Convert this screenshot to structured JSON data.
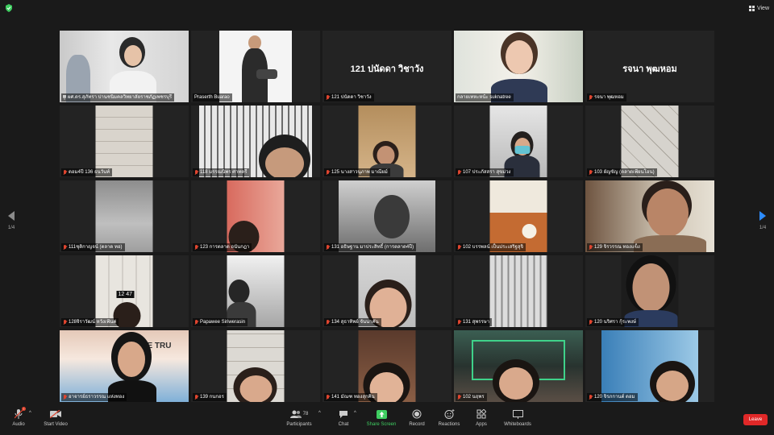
{
  "header": {
    "view_label": "View"
  },
  "pagination": {
    "left": "1/4",
    "right": "1/4"
  },
  "tiles": [
    "ผศ.ดร.สุภัทรา ปานชนิมคลวิทยาลัยราชภัฏเพชรบุรี",
    "Praserth Buarao",
    "121 ปนัดดา วิชาวัง",
    "กลายเทหะหน้ะ suknatree",
    "รจนา พุฒหอม",
    "ดอม4ปี 136 ธนวันท์",
    "118 มรรณนิพร ศาทตรี",
    "125 นางสาวนุภาพ มาณียม์",
    "107 ประภัสสรา สุขม่วง",
    "103 ผัญขัญ (ตลาดเพียนโอน)",
    "111ชุติกาญจน์ (ตลาด ทอ)",
    "123 การตลาด อนันกฎา",
    "131 อธิษฐาน มาประสิทธิ์ (การตลาด4ปี)",
    "102 บรรพลน์ เป็นประเสริฐสุจิ",
    "129 จิรวรรณ ทองแข็ง",
    "128จิราวัฒน์ หวังเฟ้นค่",
    "Papawee Siriwerasin",
    "134 สุธาทิพย์ จันนาคัน",
    "131 สุพรรษา",
    "120 นริศรา กุ้ระพงษ์",
    "อาจารย์ธราวรรณ แห่งทอง",
    "139 กนกอร",
    "141 มัณฑ ทองสุกคิน",
    "102 นฤพร",
    "120 จิรภกานต์ ดอม"
  ],
  "name_only_tiles": {
    "t2": "121 ปนัดดา วิชาวัง",
    "t4": "รจนา พุฒหอม"
  },
  "misc": {
    "clock": "12 47",
    "banner": "OVE TRU"
  },
  "toolbar": {
    "audio": "Audio",
    "start_video": "Start Video",
    "participants": "Participants",
    "participants_count": "78",
    "chat": "Chat",
    "share_screen": "Share Screen",
    "record": "Record",
    "reactions": "Reactions",
    "apps": "Apps",
    "whiteboards": "Whiteboards",
    "leave": "Leave"
  },
  "colors": {
    "background": "#1a1a1a",
    "active_speaker_border": "#c8d84a",
    "share_green": "#3fce61",
    "leave_red": "#e02828",
    "muted_red": "#e0452f",
    "nav_blue": "#2d8cff"
  }
}
